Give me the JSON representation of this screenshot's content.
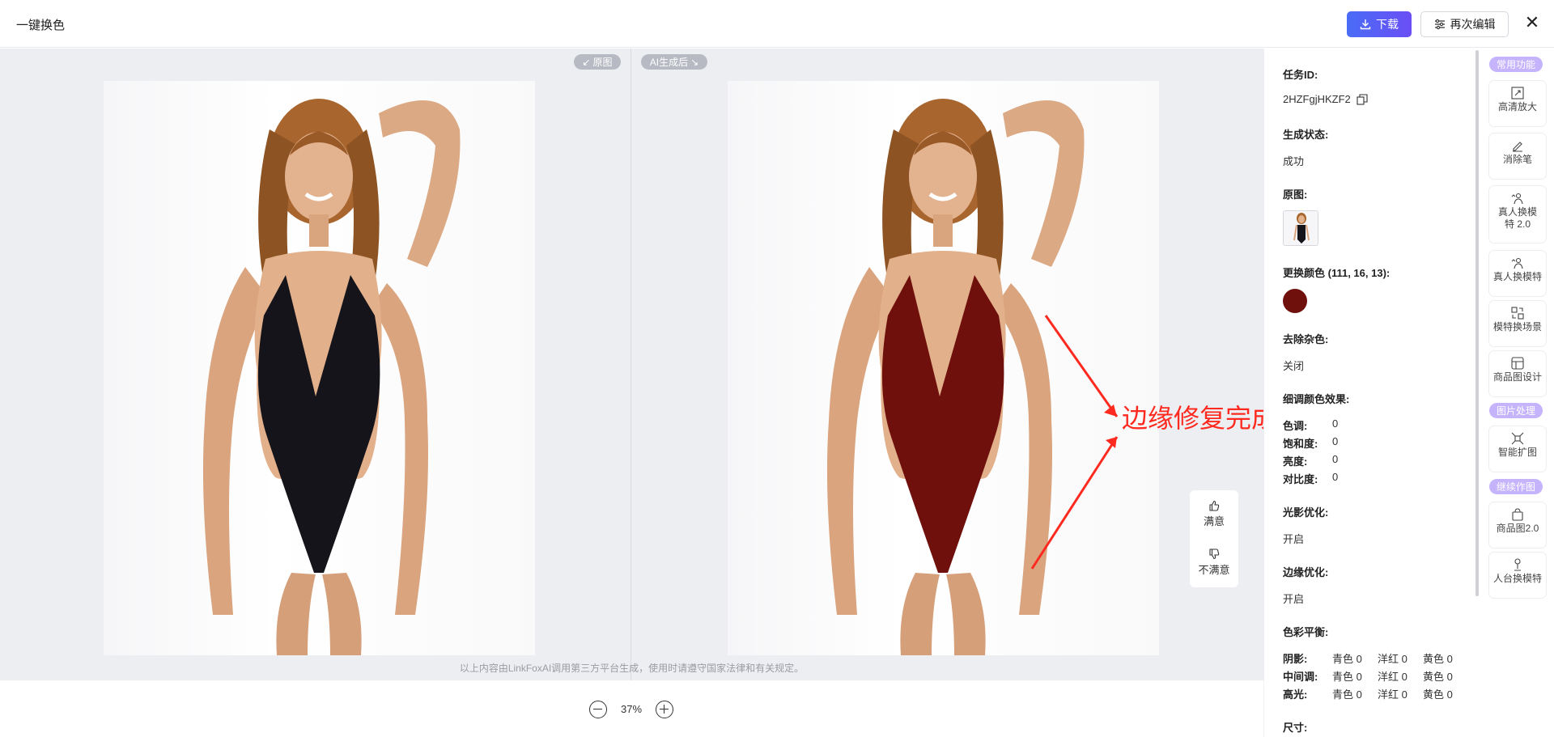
{
  "header": {
    "title": "一键换色",
    "download_label": "下载",
    "reedit_label": "再次编辑"
  },
  "canvas": {
    "tag_original": "原图",
    "tag_ai": "AI生成后",
    "disclaimer": "以上内容由LinkFoxAI调用第三方平台生成，使用时请遵守国家法律和有关规定。",
    "annotation": "边缘修复完成",
    "feedback": {
      "satisfied": "满意",
      "unsatisfied": "不满意"
    },
    "zoom_level": "37%",
    "colors": {
      "original_suit": "#15141a",
      "recolored_suit": "#6f100d"
    }
  },
  "details": {
    "task_id_label": "任务ID:",
    "task_id": "2HZFgjHKZF2",
    "status_label": "生成状态:",
    "status": "成功",
    "original_label": "原图:",
    "replace_color_label": "更换颜色 (111, 16, 13):",
    "replace_color_hex": "#6f100d",
    "denoise_label": "去除杂色:",
    "denoise": "关闭",
    "fine_tune_label": "细调颜色效果:",
    "fine_tune": [
      {
        "key": "色调:",
        "val": "0"
      },
      {
        "key": "饱和度:",
        "val": "0"
      },
      {
        "key": "亮度:",
        "val": "0"
      },
      {
        "key": "对比度:",
        "val": "0"
      }
    ],
    "lighting_label": "光影优化:",
    "lighting": "开启",
    "edge_label": "边缘优化:",
    "edge": "开启",
    "balance_label": "色彩平衡:",
    "balance": [
      {
        "key": "阴影:",
        "c": "青色 0",
        "m": "洋红 0",
        "y": "黄色 0"
      },
      {
        "key": "中间调:",
        "c": "青色 0",
        "m": "洋红 0",
        "y": "黄色 0"
      },
      {
        "key": "高光:",
        "c": "青色 0",
        "m": "洋红 0",
        "y": "黄色 0"
      }
    ],
    "size_label": "尺寸:"
  },
  "tools": {
    "section_common": "常用功能",
    "section_image": "图片处理",
    "section_continue": "继续作图",
    "items": [
      {
        "label": "高清放大",
        "icon": "upscale-icon"
      },
      {
        "label": "消除笔",
        "icon": "eraser-pen-icon"
      },
      {
        "label": "真人换模特 2.0",
        "icon": "model-swap-icon"
      },
      {
        "label": "真人换模特",
        "icon": "model-swap-icon"
      },
      {
        "label": "模特换场景",
        "icon": "scene-swap-icon"
      },
      {
        "label": "商品图设计",
        "icon": "layout-icon"
      },
      {
        "label": "智能扩图",
        "icon": "expand-icon"
      },
      {
        "label": "商品图2.0",
        "icon": "bag-icon"
      },
      {
        "label": "人台换模特",
        "icon": "mannequin-icon"
      }
    ]
  }
}
